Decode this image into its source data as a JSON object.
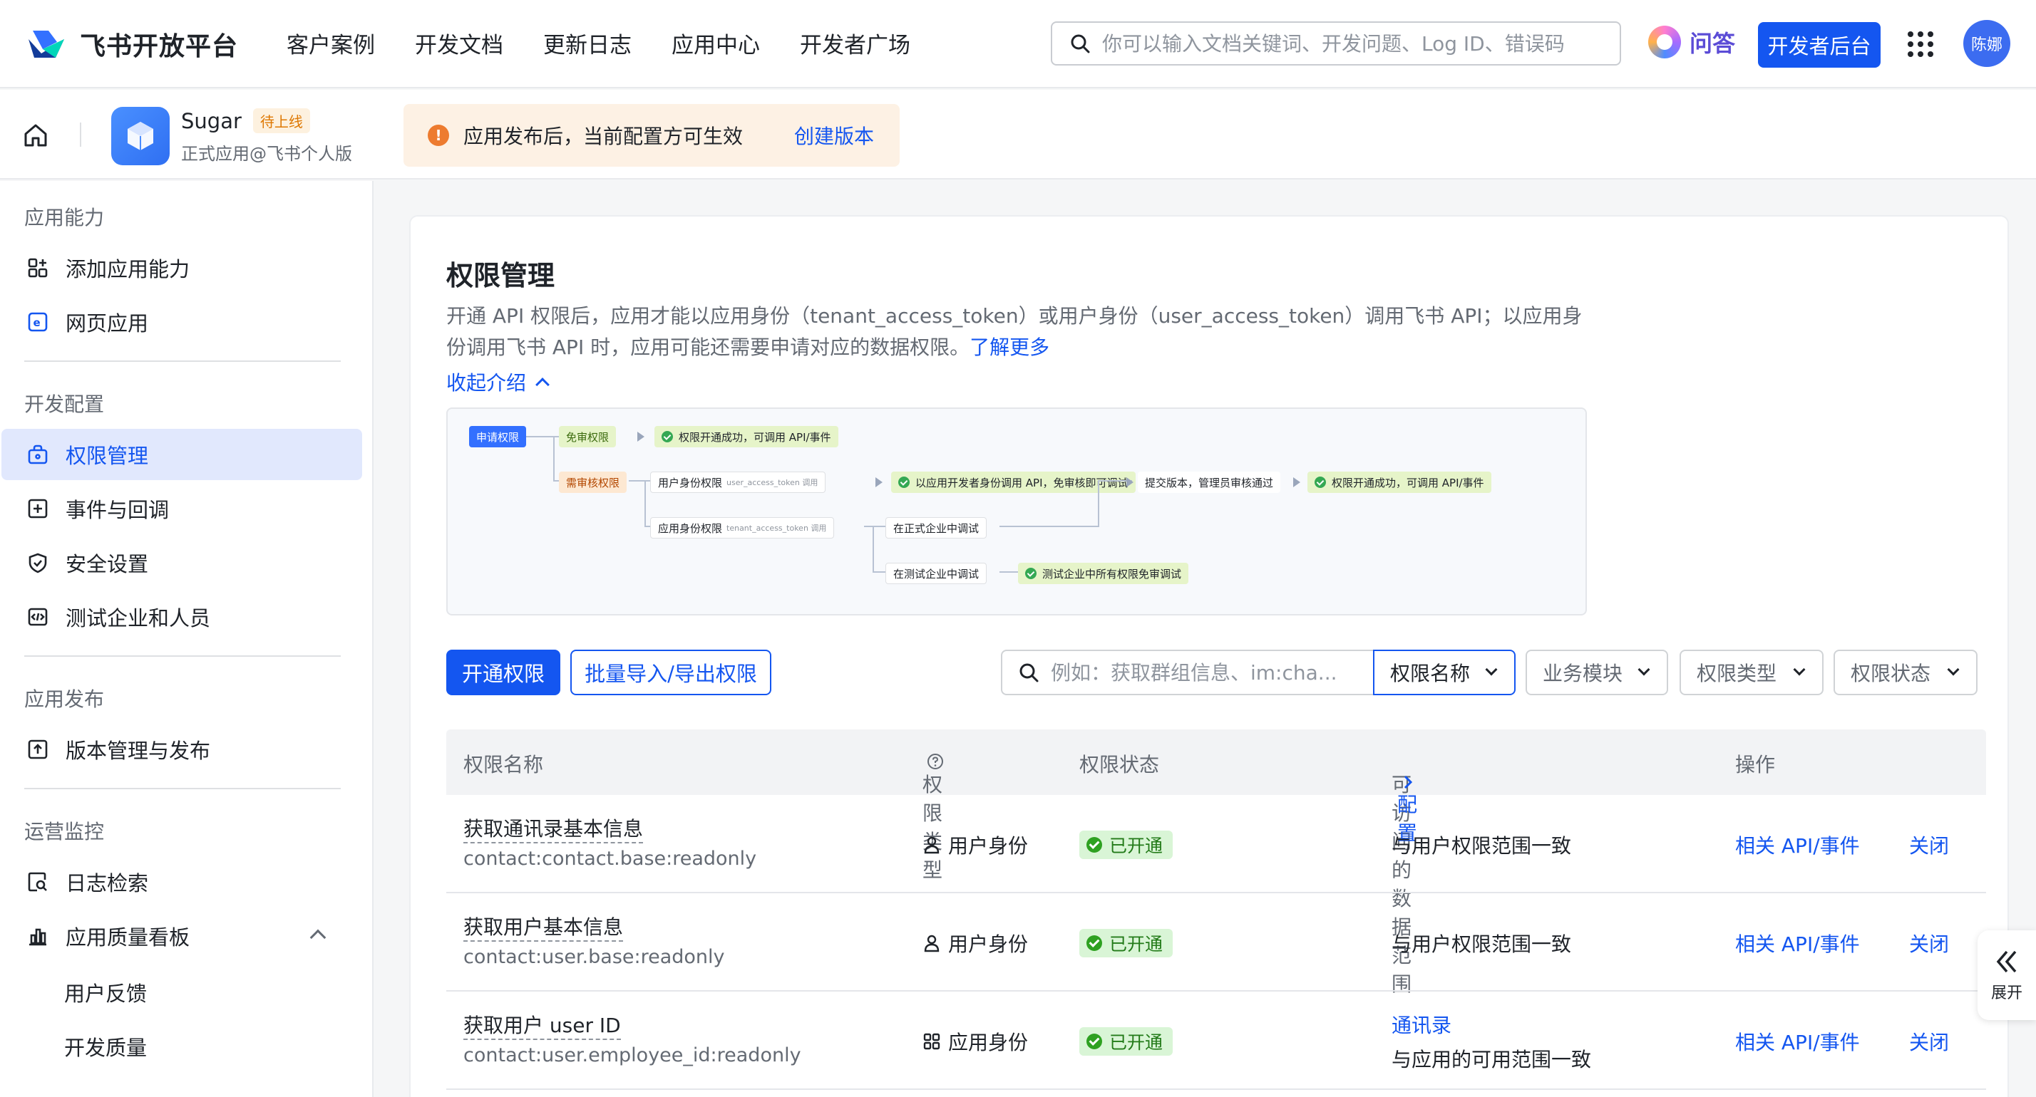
{
  "header": {
    "logo_text": "飞书开放平台",
    "nav": [
      "客户案例",
      "开发文档",
      "更新日志",
      "应用中心",
      "开发者广场"
    ],
    "search_placeholder": "你可以输入文档关键词、开发问题、Log ID、错误码",
    "qa_label": "问答",
    "dev_console_label": "开发者后台",
    "avatar_text": "陈娜"
  },
  "appbar": {
    "app_name": "Sugar",
    "app_status": "待上线",
    "app_sub": "正式应用@飞书个人版",
    "notice_text": "应用发布后，当前配置方可生效",
    "notice_link": "创建版本"
  },
  "sidebar": {
    "groups": [
      "应用能力",
      "开发配置",
      "应用发布",
      "运营监控"
    ],
    "items": [
      {
        "label": "添加应用能力",
        "icon": "grid-add-icon"
      },
      {
        "label": "网页应用",
        "icon": "web-app-icon"
      },
      {
        "label": "权限管理",
        "icon": "permission-icon",
        "active": true
      },
      {
        "label": "事件与回调",
        "icon": "event-icon"
      },
      {
        "label": "安全设置",
        "icon": "shield-icon"
      },
      {
        "label": "测试企业和人员",
        "icon": "code-icon"
      },
      {
        "label": "版本管理与发布",
        "icon": "upload-icon"
      },
      {
        "label": "日志检索",
        "icon": "log-search-icon"
      },
      {
        "label": "应用质量看板",
        "icon": "chart-icon"
      }
    ],
    "subitems": [
      "用户反馈",
      "开发质量"
    ]
  },
  "main": {
    "title": "权限管理",
    "description": "开通 API 权限后，应用才能以应用身份（tenant_access_token）或用户身份（user_access_token）调用飞书 API；以应用身份调用飞书 API 时，应用可能还需要申请对应的数据权限。",
    "learn_more": "了解更多",
    "collapse_label": "收起介绍",
    "diagram": {
      "apply": "申请权限",
      "free": "免审权限",
      "free_result": "权限开通成功，可调用 API/事件",
      "review": "需审核权限",
      "user_perm": "用户身份权限",
      "user_perm_note": "user_access_token 调用",
      "user_result": "以应用开发者身份调用 API，免审核即可调试",
      "submit": "提交版本，管理员审核通过",
      "final_result": "权限开通成功，可调用 API/事件",
      "app_perm": "应用身份权限",
      "app_perm_note": "tenant_access_token 调用",
      "prod_debug": "在正式企业中调试",
      "test_debug": "在测试企业中调试",
      "test_result": "测试企业中所有权限免审调试"
    },
    "toolbar": {
      "open_btn": "开通权限",
      "batch_btn": "批量导入/导出权限",
      "search_placeholder": "例如：获取群组信息、im:cha...",
      "filters": [
        "权限名称",
        "业务模块",
        "权限类型",
        "权限状态"
      ]
    },
    "table": {
      "headers": [
        "权限名称",
        "权限类型",
        "权限状态",
        "可访问的数据范围",
        "配置",
        "操作"
      ],
      "rows": [
        {
          "name": "获取通讯录基本信息",
          "code": "contact:contact.base:readonly",
          "type": "用户身份",
          "type_icon": "user-icon",
          "status": "已开通",
          "scope_link": "",
          "scope": "与用户权限范围一致",
          "action1": "相关 API/事件",
          "action2": "关闭"
        },
        {
          "name": "获取用户基本信息",
          "code": "contact:user.base:readonly",
          "type": "用户身份",
          "type_icon": "user-icon",
          "status": "已开通",
          "scope_link": "",
          "scope": "与用户权限范围一致",
          "action1": "相关 API/事件",
          "action2": "关闭"
        },
        {
          "name": "获取用户 user ID",
          "code": "contact:user.employee_id:readonly",
          "type": "应用身份",
          "type_icon": "app-grid-icon",
          "status": "已开通",
          "scope_link": "通讯录",
          "scope": "与应用的可用范围一致",
          "action1": "相关 API/事件",
          "action2": "关闭"
        }
      ]
    },
    "expand_label": "展开"
  }
}
